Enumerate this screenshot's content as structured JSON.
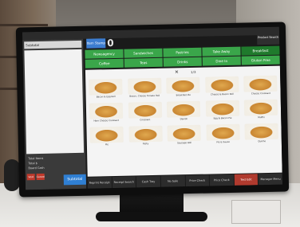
{
  "pos": {
    "topbar_text": "",
    "order_title": "Subtotal",
    "order_number_label": "Item Stamp",
    "order_number_big": "0",
    "search_label": "Product Search",
    "categories": [
      {
        "label": "Newsagency",
        "selected": false
      },
      {
        "label": "Sandwiches",
        "selected": false
      },
      {
        "label": "Pastries",
        "selected": false
      },
      {
        "label": "Take Away",
        "selected": false
      },
      {
        "label": "Cakes",
        "selected": false
      },
      {
        "label": "Coffee",
        "selected": false
      },
      {
        "label": "Teas",
        "selected": false
      },
      {
        "label": "Drinks",
        "selected": false
      },
      {
        "label": "Dine In",
        "selected": false
      },
      {
        "label": "Gluten Free",
        "selected": false
      }
    ],
    "breakfast_label": "Breakfast",
    "sub_cat_label": "Clear Department",
    "page_indicator": "1/3",
    "items": [
      {
        "label": "Bacon & Egg Roll"
      },
      {
        "label": "Bacon, Cheese Tomato Roll"
      },
      {
        "label": "Breakfast Pie"
      },
      {
        "label": "Cheese & Bacon Roll"
      },
      {
        "label": "Cheese Croissant"
      },
      {
        "label": "Ham Cheese Croissant"
      },
      {
        "label": "Croissant"
      },
      {
        "label": "Danish"
      },
      {
        "label": "Egg & Bacon Pie"
      },
      {
        "label": "Muffin"
      },
      {
        "label": "Pie"
      },
      {
        "label": "Pasty"
      },
      {
        "label": "Sausage Roll"
      },
      {
        "label": "Pie & Sauce"
      },
      {
        "label": "Quiche"
      }
    ],
    "totals": [
      "Total Items",
      "Total $",
      "Board Cash"
    ],
    "left_buttons": [
      "Void",
      "Cancel"
    ],
    "subtotal_button": "Subtotal",
    "bottom_buttons": [
      {
        "label": "Reprint Receipt",
        "red": false
      },
      {
        "label": "Receipt Search",
        "red": false
      },
      {
        "label": "Cash Tray",
        "red": false
      },
      {
        "label": "No Sale",
        "red": false
      },
      {
        "label": "Price Check",
        "red": false
      },
      {
        "label": "Price Check",
        "red": false
      },
      {
        "label": "Text Edit",
        "red": true
      },
      {
        "label": "Manager Menu",
        "red": false
      }
    ]
  }
}
